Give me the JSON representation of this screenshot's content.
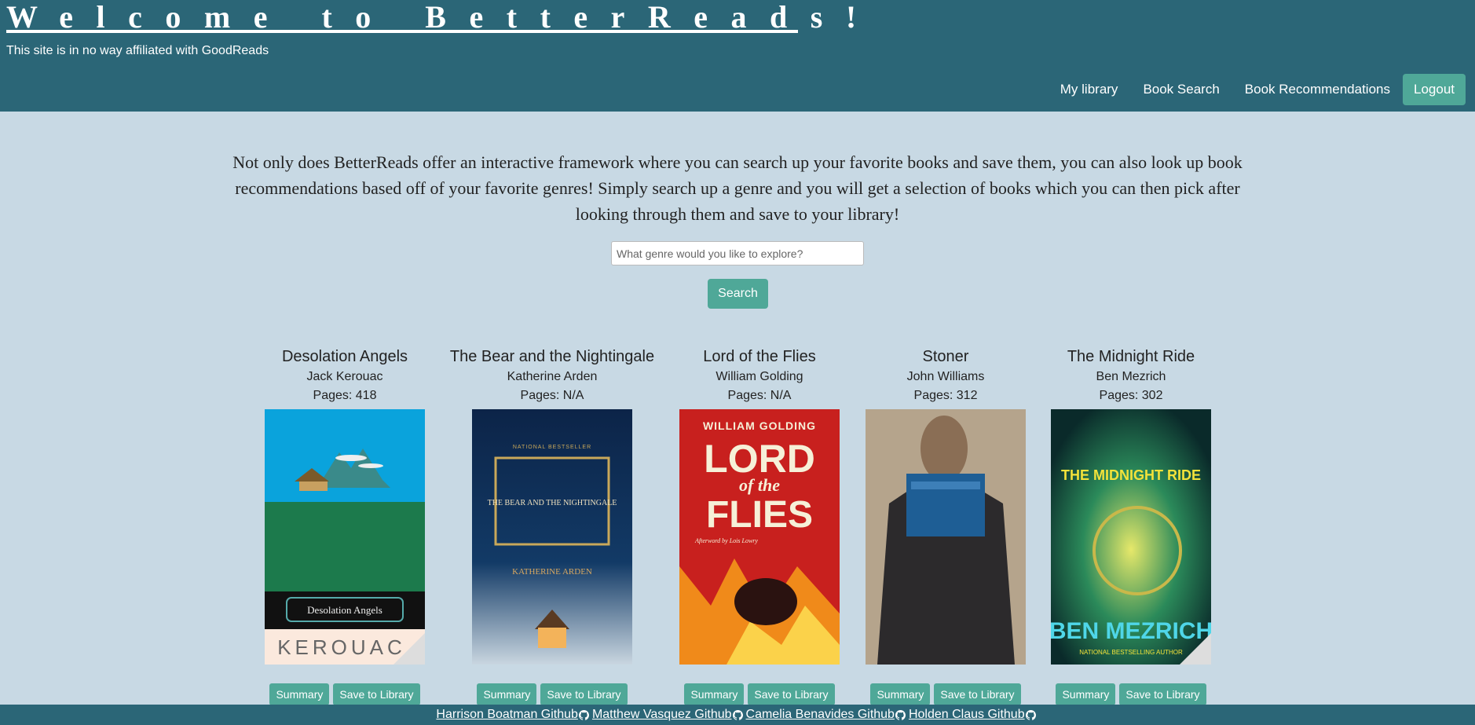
{
  "header": {
    "title": "Welcome to BetterReads!",
    "disclaimer": "This site is in no way affiliated with GoodReads"
  },
  "nav": {
    "library": "My library",
    "search": "Book Search",
    "recommendations": "Book Recommendations",
    "logout": "Logout"
  },
  "intro": "Not only does BetterReads offer an interactive framework where you can search up your favorite books and save them, you can also look up book recommendations based off of your favorite genres! Simply search up a genre and you will get a selection of books which you can then pick after looking through them and save to your library!",
  "search": {
    "placeholder": "What genre would you like to explore?",
    "value": "",
    "button": "Search"
  },
  "books": [
    {
      "title": "Desolation Angels",
      "author": "Jack Kerouac",
      "pages": "Pages: 418",
      "cover_text": [
        "Desolation Angels",
        "KEROUAC"
      ],
      "summary": "Summary",
      "save": "Save to Library"
    },
    {
      "title": "The Bear and the Nightingale",
      "author": "Katherine Arden",
      "pages": "Pages: N/A",
      "cover_text": [
        "THE BEAR AND THE NIGHTINGALE",
        "KATHERINE ARDEN",
        "NATIONAL BESTSELLER"
      ],
      "summary": "Summary",
      "save": "Save to Library"
    },
    {
      "title": "Lord of the Flies",
      "author": "William Golding",
      "pages": "Pages: N/A",
      "cover_text": [
        "WILLIAM GOLDING",
        "LORD",
        "of the",
        "FLIES",
        "Afterword by Lois Lowry"
      ],
      "summary": "Summary",
      "save": "Save to Library"
    },
    {
      "title": "Stoner",
      "author": "John Williams",
      "pages": "Pages: 312",
      "cover_text": [],
      "summary": "Summary",
      "save": "Save to Library"
    },
    {
      "title": "The Midnight Ride",
      "author": "Ben Mezrich",
      "pages": "Pages: 302",
      "cover_text": [
        "THE MIDNIGHT RIDE",
        "BEN MEZRICH",
        "NATIONAL BESTSELLING AUTHOR"
      ],
      "summary": "Summary",
      "save": "Save to Library"
    }
  ],
  "footer": {
    "links": [
      "Harrison Boatman Github",
      "Matthew Vasquez Github",
      "Camelia Benavides Github",
      "Holden Claus Github"
    ],
    "icon": "github-icon"
  },
  "colors": {
    "header_bg": "#2b6677",
    "page_bg": "#c8d9e4",
    "accent": "#4fa898"
  }
}
